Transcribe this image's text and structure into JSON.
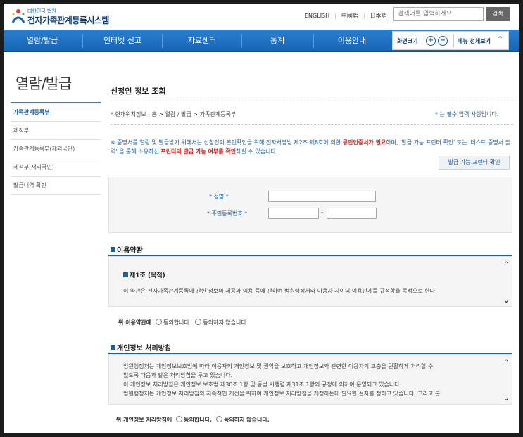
{
  "header": {
    "logo_small": "대한민국 법원",
    "logo_title": "전자가족관계등록시스템",
    "languages": [
      "ENGLISH",
      "中國語",
      "日本語"
    ],
    "search_placeholder": "검색어를 입력하세요.",
    "search_button": "검색",
    "zoom_label": "화면크기",
    "zoom_in": "+",
    "zoom_out": "−",
    "menu_all": "메뉴 전체보기",
    "menu_all_icon": "chevron-up-icon"
  },
  "nav": [
    "열람/발급",
    "인터넷 신고",
    "자료센터",
    "통계",
    "이용안내"
  ],
  "sidebar": {
    "title": "열람/발급",
    "items": [
      "가족관계등록부",
      "제적부",
      "가족관계등록부(재외국민)",
      "제적부(재외국민)",
      "발급내역 확인"
    ],
    "active_index": 0
  },
  "content": {
    "title": "신청인 정보 조회",
    "breadcrumb": "* 현재위치정보 : 홈 > 열람 / 발급 > 가족관계등록부",
    "required_note": "* 는 필수 입력 사항입니다.",
    "notice_part1": "※ 증명서를 열람 및 발급받기 위해서는 신청인의 본인확인을 위해 전자서명법 제2조 제8호에 의한 ",
    "notice_red1": "공인인증서가 필요",
    "notice_part2": "하며, '발급 가능 프린터 확인' 또는 '테스트 증명서 출력' 을 통해 소유하신 ",
    "notice_red2": "프린터의 발급 가능 여부를 확인",
    "notice_part3": "하실 수 있습니다.",
    "printer_button": "발급 가능 프린터 확인",
    "form": {
      "name_label": "* 성명 *",
      "rrn_label": "* 주민등록번호 *",
      "rrn_separator": "-"
    },
    "terms": {
      "section_title": "이용약관",
      "article_title": "제1조 (목적)",
      "article_text": "이 약관은 전자가족관계등록에 관한 정보의 제공과 이용 등에 관하여 법원행정처와 이용자 사이의 이용관계를 규정함을 목적으로 한다.",
      "agree_prefix": "위 이용약관에",
      "agree_yes": "동의합니다.",
      "agree_no": "동의하지 않습니다."
    },
    "privacy": {
      "section_title": "개인정보 처리방침",
      "lines": [
        "법원행정처는 개인정보보호법에 따라 이용자의 개인정보 및 권익을 보호하고 개인정보와 관련한 이용자의 고충을 원활하게 처리할 수",
        "있도록 다음과 같은 처리방침을 두고 있습니다.",
        "이 개인정보 처리방침은 개인정보 보호법 제30조 1항 및 동법 시행령 제31조 1항의 규정에 의하여 운영되고 있습니다.",
        "법원행정처는 개인정보 처리방침의 지속적인 개선을 위하여 개인정보 처리방침을 개정하는데 필요한 절차를 정하고 있습니다. 그리고 본"
      ],
      "agree_prefix": "위 개인정보 처리방침에",
      "agree_yes": "동의합니다.",
      "agree_no": "동의하지 않습니다."
    }
  },
  "colors": {
    "brand": "#1a5fa8",
    "nav": "#1865b8",
    "alert": "#e02020"
  }
}
